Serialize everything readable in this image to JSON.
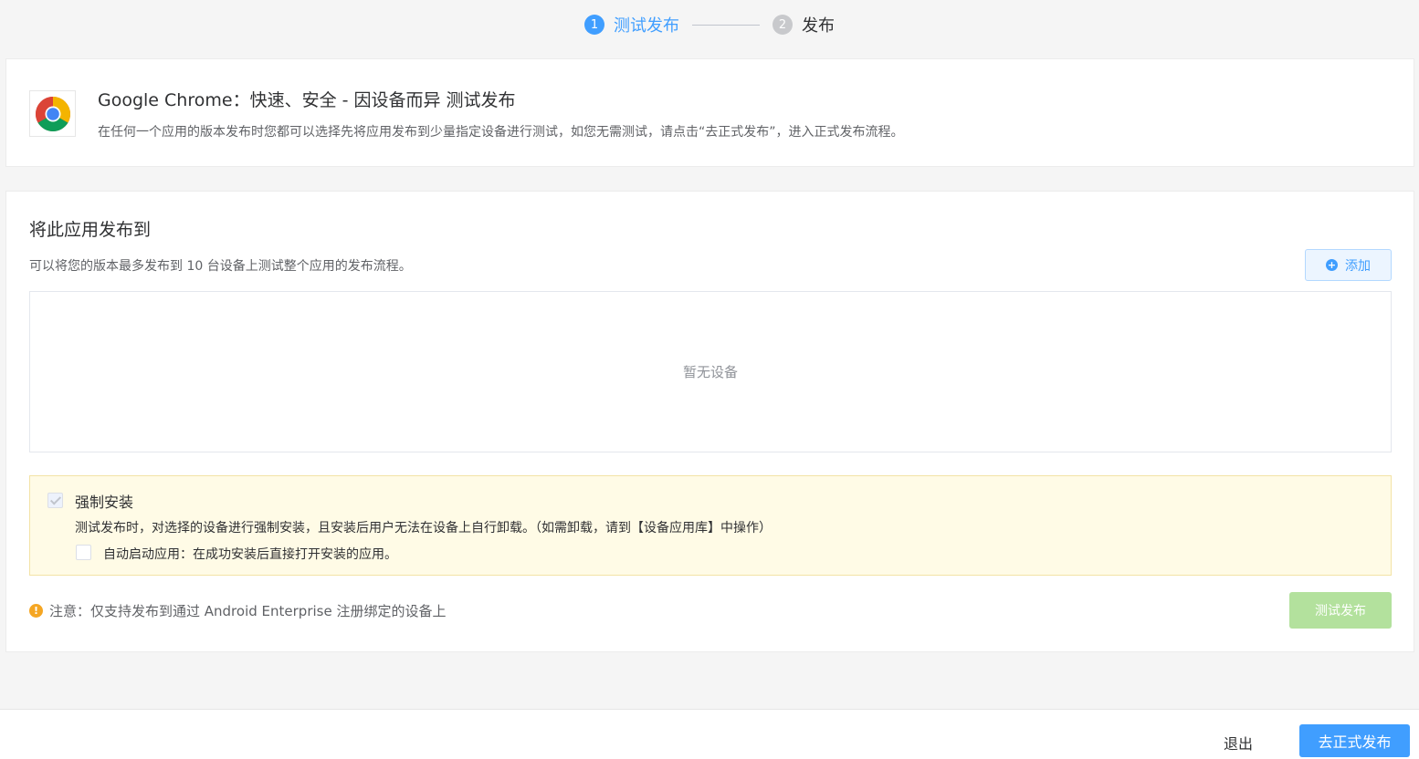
{
  "stepper": {
    "steps": [
      {
        "number": "1",
        "label": "测试发布",
        "state": "active"
      },
      {
        "number": "2",
        "label": "发布",
        "state": "pending"
      }
    ]
  },
  "app": {
    "icon": "chrome-icon",
    "title": "Google Chrome：快速、安全 - 因设备而异 测试发布",
    "description": "在任何一个应用的版本发布时您都可以选择先将应用发布到少量指定设备进行测试，如您无需测试，请点击“去正式发布”，进入正式发布流程。"
  },
  "publish": {
    "title": "将此应用发布到",
    "hint": "可以将您的版本最多发布到 10 台设备上测试整个应用的发布流程。",
    "add_button": "添加",
    "empty_text": "暂无设备",
    "force_install": {
      "label": "强制安装",
      "checked": true,
      "disabled": true,
      "description": "测试发布时，对选择的设备进行强制安装，且安装后用户无法在设备上自行卸载。（如需卸载，请到【设备应用库】中操作）"
    },
    "auto_launch": {
      "label": "自动启动应用：在成功安装后直接打开安装的应用。",
      "checked": false
    },
    "warning": "注意：仅支持发布到通过 Android Enterprise 注册绑定的设备上",
    "test_publish_button": "测试发布"
  },
  "footer": {
    "exit_label": "退出",
    "go_publish_label": "去正式发布"
  },
  "colors": {
    "primary": "#409eff",
    "success_disabled": "#b3e19d",
    "warning": "#f5a623",
    "notice_bg": "#fffbe6"
  }
}
